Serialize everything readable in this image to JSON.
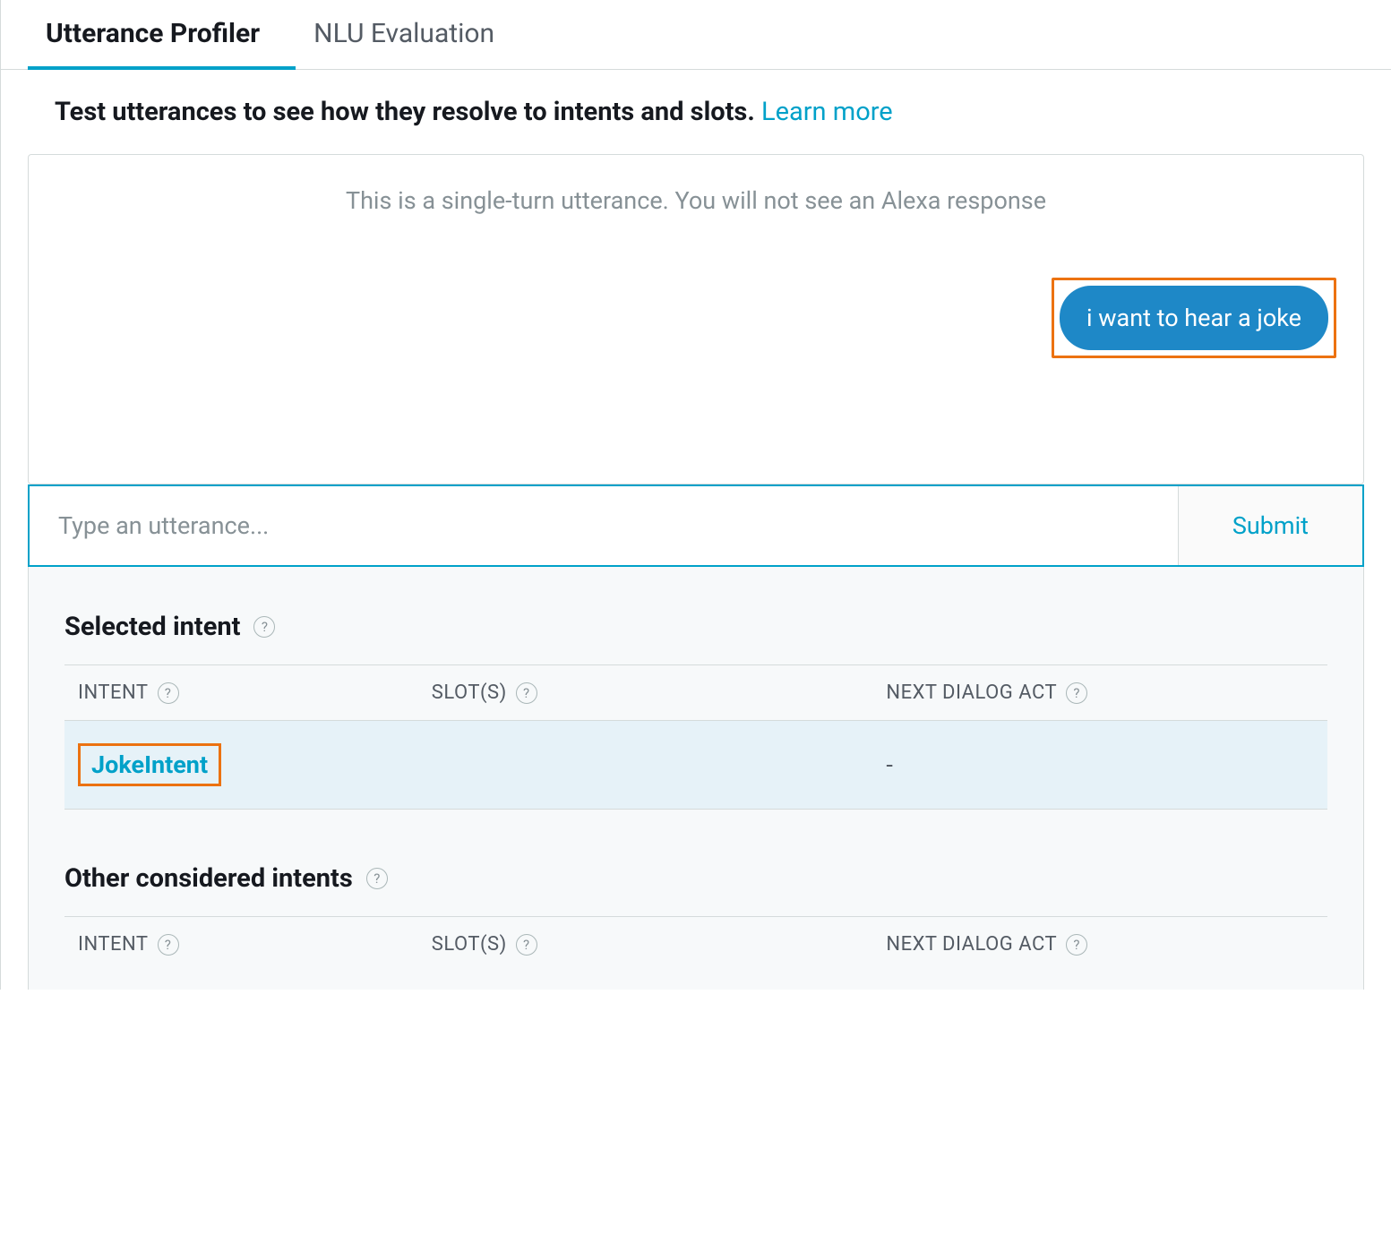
{
  "tabs": {
    "profiler": "Utterance Profiler",
    "nlu": "NLU Evaluation"
  },
  "intro": {
    "text": "Test utterances to see how they resolve to intents and slots. ",
    "link": "Learn more"
  },
  "chat": {
    "notice": "This is a single-turn utterance. You will not see an Alexa response",
    "user_utterance": "i want to hear a joke"
  },
  "input": {
    "placeholder": "Type an utterance...",
    "value": "",
    "submit_label": "Submit"
  },
  "selected_intent": {
    "title": "Selected intent",
    "columns": {
      "intent": "INTENT",
      "slots": "SLOT(S)",
      "dialog": "NEXT DIALOG ACT"
    },
    "row": {
      "intent": "JokeIntent",
      "slots": "",
      "dialog": "-"
    }
  },
  "other_intents": {
    "title": "Other considered intents",
    "columns": {
      "intent": "INTENT",
      "slots": "SLOT(S)",
      "dialog": "NEXT DIALOG ACT"
    }
  },
  "icons": {
    "help": "?"
  }
}
